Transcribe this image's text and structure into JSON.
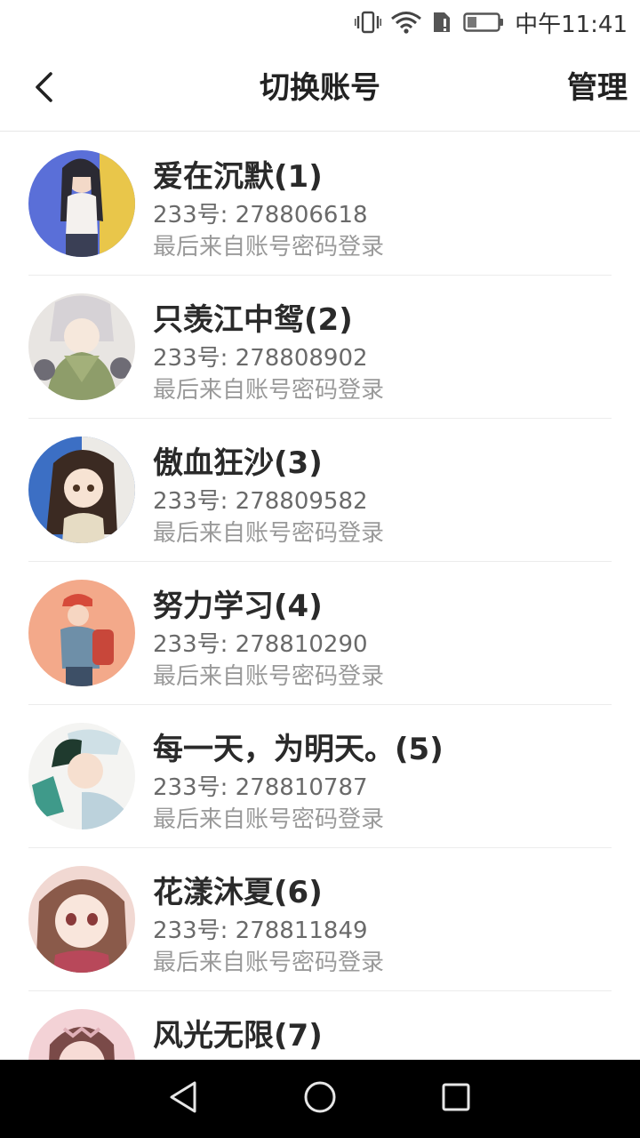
{
  "status_bar": {
    "time": "中午11:41",
    "icons": [
      "vibrate-icon",
      "wifi-icon",
      "sim-icon",
      "battery-icon"
    ]
  },
  "header": {
    "title": "切换账号",
    "manage_label": "管理",
    "back_icon": "back-arrow-icon"
  },
  "accounts": [
    {
      "name": "爱在沉默(1)",
      "id_line": "233号: 278806618",
      "login_line": "最后来自账号密码登录"
    },
    {
      "name": "只羡江中鸳(2)",
      "id_line": "233号: 278808902",
      "login_line": "最后来自账号密码登录"
    },
    {
      "name": "傲血狂沙(3)",
      "id_line": "233号: 278809582",
      "login_line": "最后来自账号密码登录"
    },
    {
      "name": "努力学习(4)",
      "id_line": "233号: 278810290",
      "login_line": "最后来自账号密码登录"
    },
    {
      "name": "每一天，为明天。(5)",
      "id_line": "233号: 278810787",
      "login_line": "最后来自账号密码登录"
    },
    {
      "name": "花漾沐夏(6)",
      "id_line": "233号: 278811849",
      "login_line": "最后来自账号密码登录"
    },
    {
      "name": "风光无限(7)",
      "id_line": "",
      "login_line": ""
    }
  ],
  "nav_bar": {
    "icons": [
      "back-triangle-icon",
      "home-circle-icon",
      "recents-square-icon"
    ]
  },
  "colors": {
    "title_text": "#222222",
    "secondary_text": "#6a6a6a",
    "tertiary_text": "#9a9a9a",
    "divider": "#ececec",
    "nav_bar_bg": "#000000"
  }
}
